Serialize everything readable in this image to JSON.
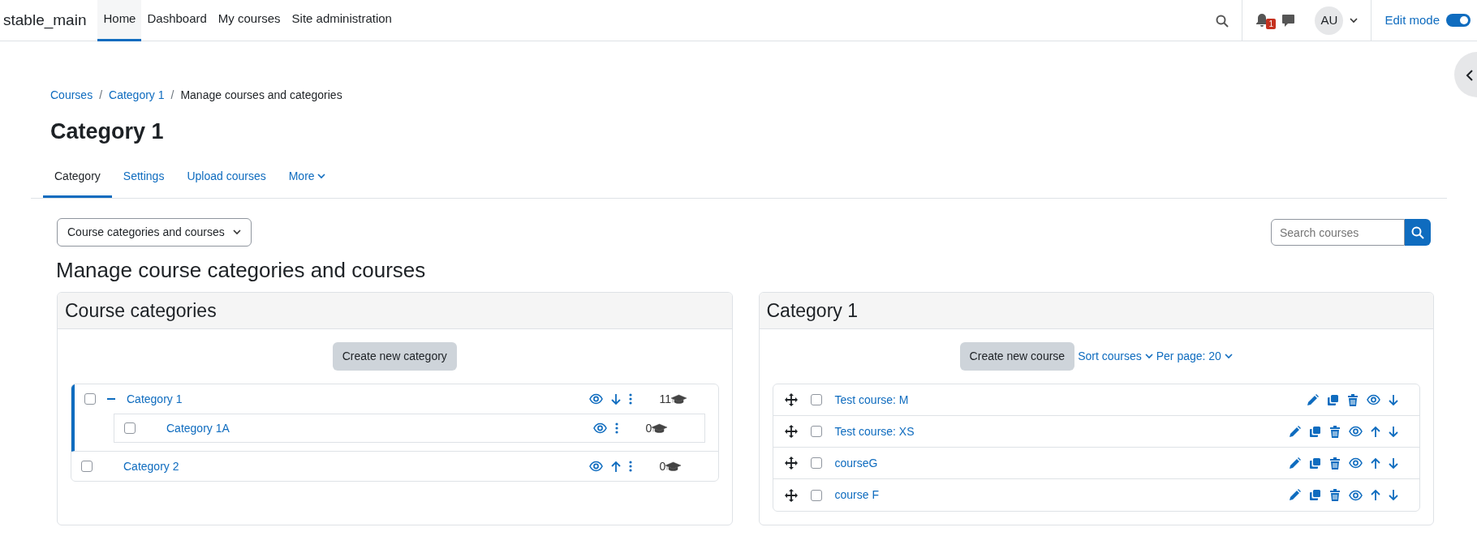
{
  "site_name": "stable_main",
  "nav": [
    {
      "label": "Home",
      "selected": true
    },
    {
      "label": "Dashboard",
      "selected": false
    },
    {
      "label": "My courses",
      "selected": false
    },
    {
      "label": "Site administration",
      "selected": false
    }
  ],
  "notifications": {
    "count": "1"
  },
  "user": {
    "initials": "AU"
  },
  "edit_mode": {
    "label": "Edit mode",
    "on": true
  },
  "breadcrumb": {
    "separator": "/",
    "items": [
      "Courses",
      "Category 1",
      "Manage courses and categories"
    ]
  },
  "page_title": "Category 1",
  "tabs": [
    {
      "label": "Category",
      "selected": true,
      "kind": "link"
    },
    {
      "label": "Settings",
      "selected": false,
      "kind": "link"
    },
    {
      "label": "Upload courses",
      "selected": false,
      "kind": "link"
    },
    {
      "label": "More",
      "selected": false,
      "kind": "menu"
    }
  ],
  "view_select": {
    "value": "Course categories and courses"
  },
  "search": {
    "placeholder": "Search courses"
  },
  "heading": "Manage course categories and courses",
  "categories_panel": {
    "title": "Course categories",
    "button": "Create new category",
    "items": [
      {
        "name": "Category 1",
        "checked": false,
        "selected": true,
        "expanded": true,
        "can_move_up": false,
        "can_move_down": true,
        "course_count": "11",
        "children": [
          {
            "name": "Category 1A",
            "checked": false,
            "selected": false,
            "can_move_up": false,
            "can_move_down": false,
            "course_count": "0"
          }
        ]
      },
      {
        "name": "Category 2",
        "checked": false,
        "selected": false,
        "can_move_up": true,
        "can_move_down": false,
        "course_count": "0"
      }
    ]
  },
  "courses_panel": {
    "title": "Category 1",
    "button": "Create new course",
    "sort_label": "Sort courses",
    "per_page_label": "Per page: 20",
    "courses": [
      {
        "name": "Test course: M",
        "checked": false,
        "can_move_up": false,
        "can_move_down": true
      },
      {
        "name": "Test course: XS",
        "checked": false,
        "can_move_up": true,
        "can_move_down": true
      },
      {
        "name": "courseG",
        "checked": false,
        "can_move_up": true,
        "can_move_down": true
      },
      {
        "name": "course F",
        "checked": false,
        "can_move_up": true,
        "can_move_down": true
      }
    ]
  }
}
